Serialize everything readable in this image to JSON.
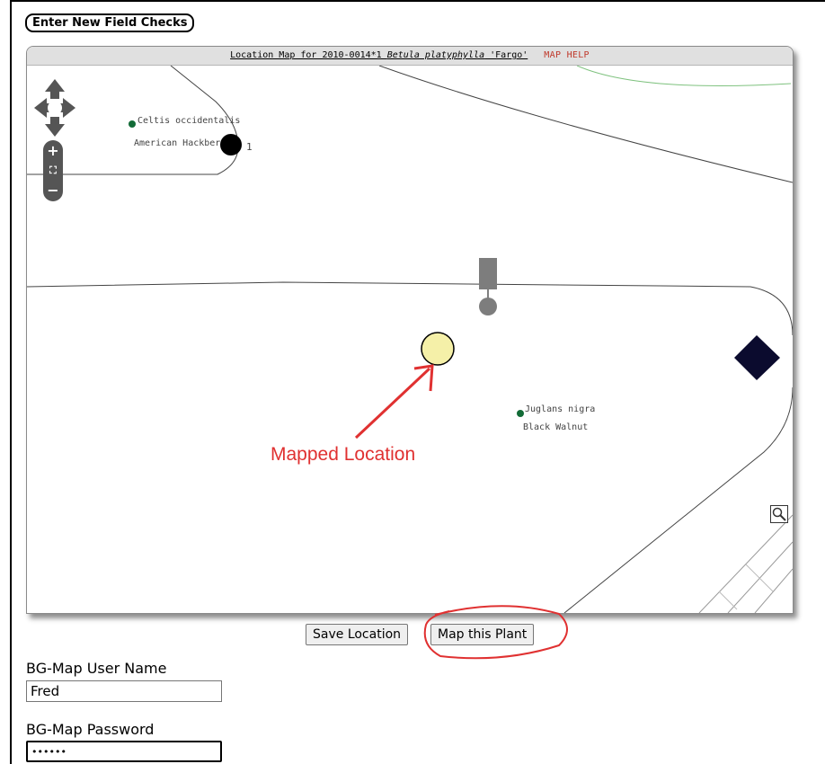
{
  "page": {
    "field_checks_button": "Enter New Field Checks",
    "save_location_button": "Save Location",
    "map_this_plant_button": "Map this Plant"
  },
  "map": {
    "header": {
      "prefix": "Location Map for 2010-0014*1 ",
      "genus_species": "Betula platyphylla",
      "cultivar": " 'Fargo'",
      "help": "MAP HELP"
    },
    "plants": [
      {
        "scientific": "Celtis occidentalis",
        "common": "American Hackberry"
      },
      {
        "scientific": "Juglans nigra",
        "common": "Black Walnut"
      }
    ],
    "marker_label": "1",
    "annotation": "Mapped Location"
  },
  "login": {
    "username_label": "BG-Map User Name",
    "username_value": "Fred",
    "password_label": "BG-Map Password",
    "password_value": "••••••"
  },
  "colors": {
    "annotation": "#e03131",
    "tree_dot": "#126b37",
    "mapped_marker_fill": "#f5f0a8",
    "building_marker": "#0b0b2e"
  },
  "icons": [
    "pan-arrows-icon",
    "zoom-in-icon",
    "zoom-extent-icon",
    "zoom-out-icon",
    "magnifier-icon"
  ]
}
